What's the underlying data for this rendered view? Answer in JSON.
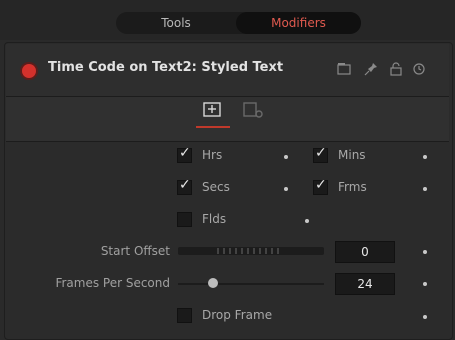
{
  "tabs": [
    "Tools",
    "Modifiers"
  ],
  "header": {
    "title": "Time Code on Text2: Styled Text"
  },
  "checkboxes": [
    {
      "label": "Hrs",
      "checked": true
    },
    {
      "label": "Mins",
      "checked": true
    },
    {
      "label": "Secs",
      "checked": true
    },
    {
      "label": "Frms",
      "checked": true
    },
    {
      "label": "Flds",
      "checked": false
    },
    {
      "label": "Drop Frame",
      "checked": false
    }
  ],
  "start_offset": {
    "label": "Start Offset",
    "value": "0"
  },
  "fps": {
    "label": "Frames Per Second",
    "value": "24"
  },
  "colors": {
    "accent": "#e05a4f",
    "toggle": "#d4312c"
  },
  "icons": [
    "film-icon",
    "pin-icon",
    "lock-icon",
    "reset-icon",
    "controls-tab-icon",
    "settings-tab-icon"
  ]
}
